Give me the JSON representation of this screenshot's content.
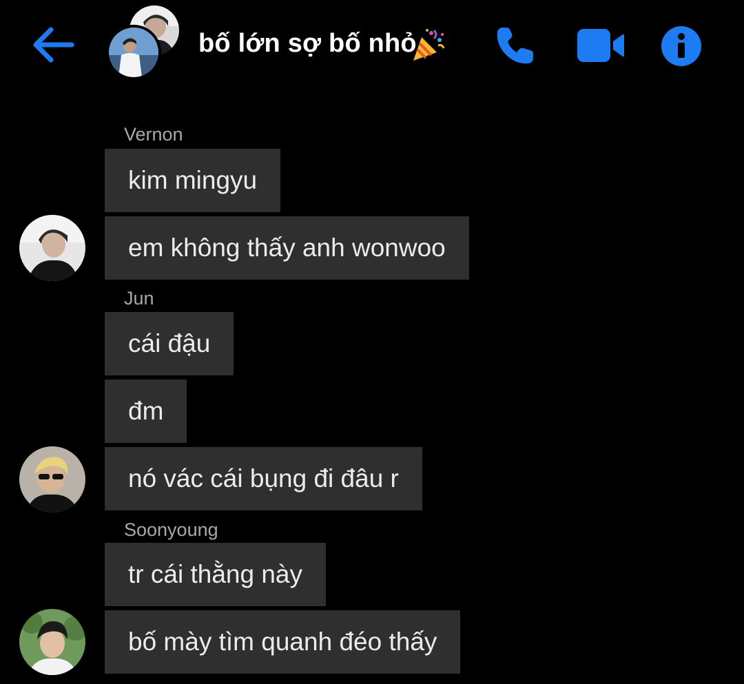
{
  "header": {
    "title": "bố lớn sợ bố nhỏ",
    "title_emoji": "party-popper-icon",
    "back_icon": "arrow-left-icon",
    "call_icon": "phone-icon",
    "video_icon": "video-camera-icon",
    "info_icon": "info-icon",
    "accent_color": "#1e7cf2"
  },
  "messages": {
    "vernon": {
      "sender": "Vernon",
      "texts": [
        "kim mingyu",
        "em không thấy anh wonwoo"
      ]
    },
    "jun": {
      "sender": "Jun",
      "texts": [
        "cái đậu",
        "đm",
        "nó vác cái bụng đi đâu r"
      ]
    },
    "soonyoung": {
      "sender": "Soonyoung",
      "texts": [
        "tr cái thằng này",
        "bố mày tìm quanh đéo thấy"
      ]
    }
  },
  "colors": {
    "background": "#000000",
    "bubble": "#2f2f2f",
    "sender_name": "#a8a8a8"
  }
}
